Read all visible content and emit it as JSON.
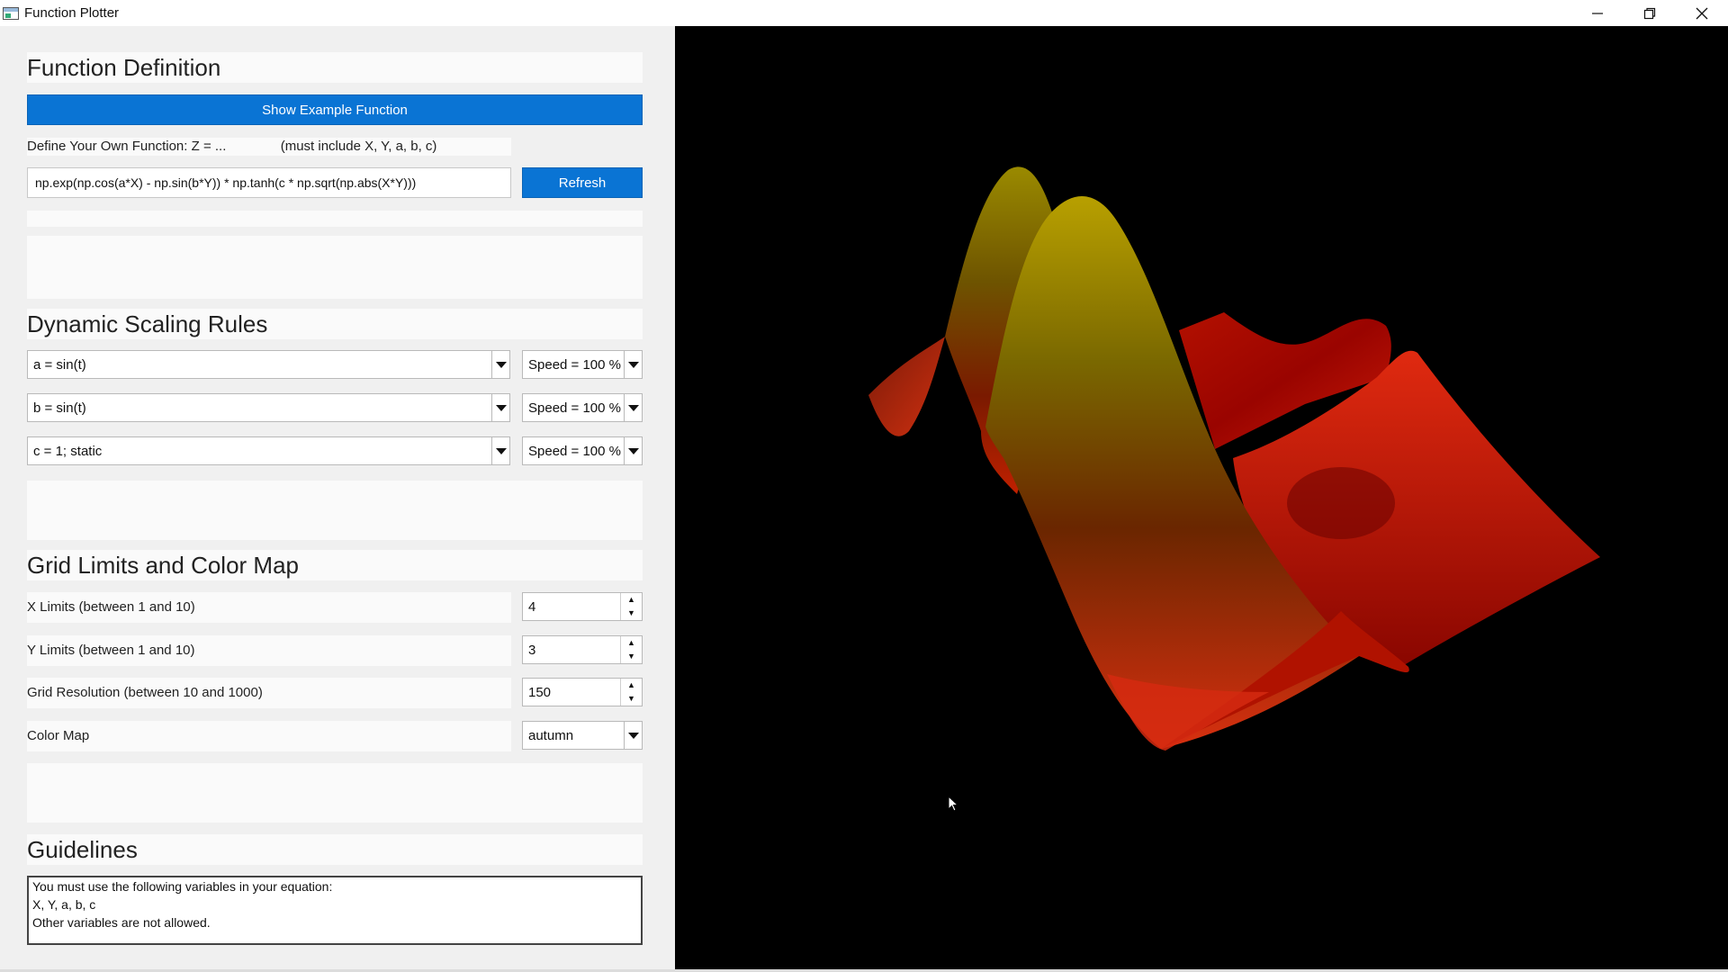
{
  "window": {
    "title": "Function Plotter",
    "controls": [
      "minimize",
      "restore",
      "close"
    ]
  },
  "function_definition": {
    "title": "Function Definition",
    "example_button": "Show Example Function",
    "define_label": "Define Your Own Function: Z = ...",
    "define_hint": "(must include X, Y, a, b, c)",
    "function_value": "np.exp(np.cos(a*X) - np.sin(b*Y)) * np.tanh(c * np.sqrt(np.abs(X*Y)))",
    "refresh_button": "Refresh"
  },
  "scaling": {
    "title": "Dynamic Scaling Rules",
    "rules": [
      {
        "rule": "a = sin(t)",
        "speed": "Speed = 100 %"
      },
      {
        "rule": "b = sin(t)",
        "speed": "Speed = 100 %"
      },
      {
        "rule": "c = 1; static",
        "speed": "Speed = 100 %"
      }
    ]
  },
  "grid": {
    "title": "Grid Limits and Color Map",
    "x_limits_label": "X Limits (between 1 and 10)",
    "x_limits_value": "4",
    "y_limits_label": "Y Limits (between 1 and 10)",
    "y_limits_value": "3",
    "resolution_label": "Grid Resolution (between 10 and 1000)",
    "resolution_value": "150",
    "colormap_label": "Color Map",
    "colormap_value": "autumn"
  },
  "guidelines": {
    "title": "Guidelines",
    "lines": [
      "You must use the following variables in your equation:",
      "X, Y, a, b, c",
      "Other variables are not allowed."
    ]
  },
  "colors": {
    "accent": "#0a74d4",
    "panel_bg": "#f0f0f0",
    "plot_bg": "#000000"
  }
}
